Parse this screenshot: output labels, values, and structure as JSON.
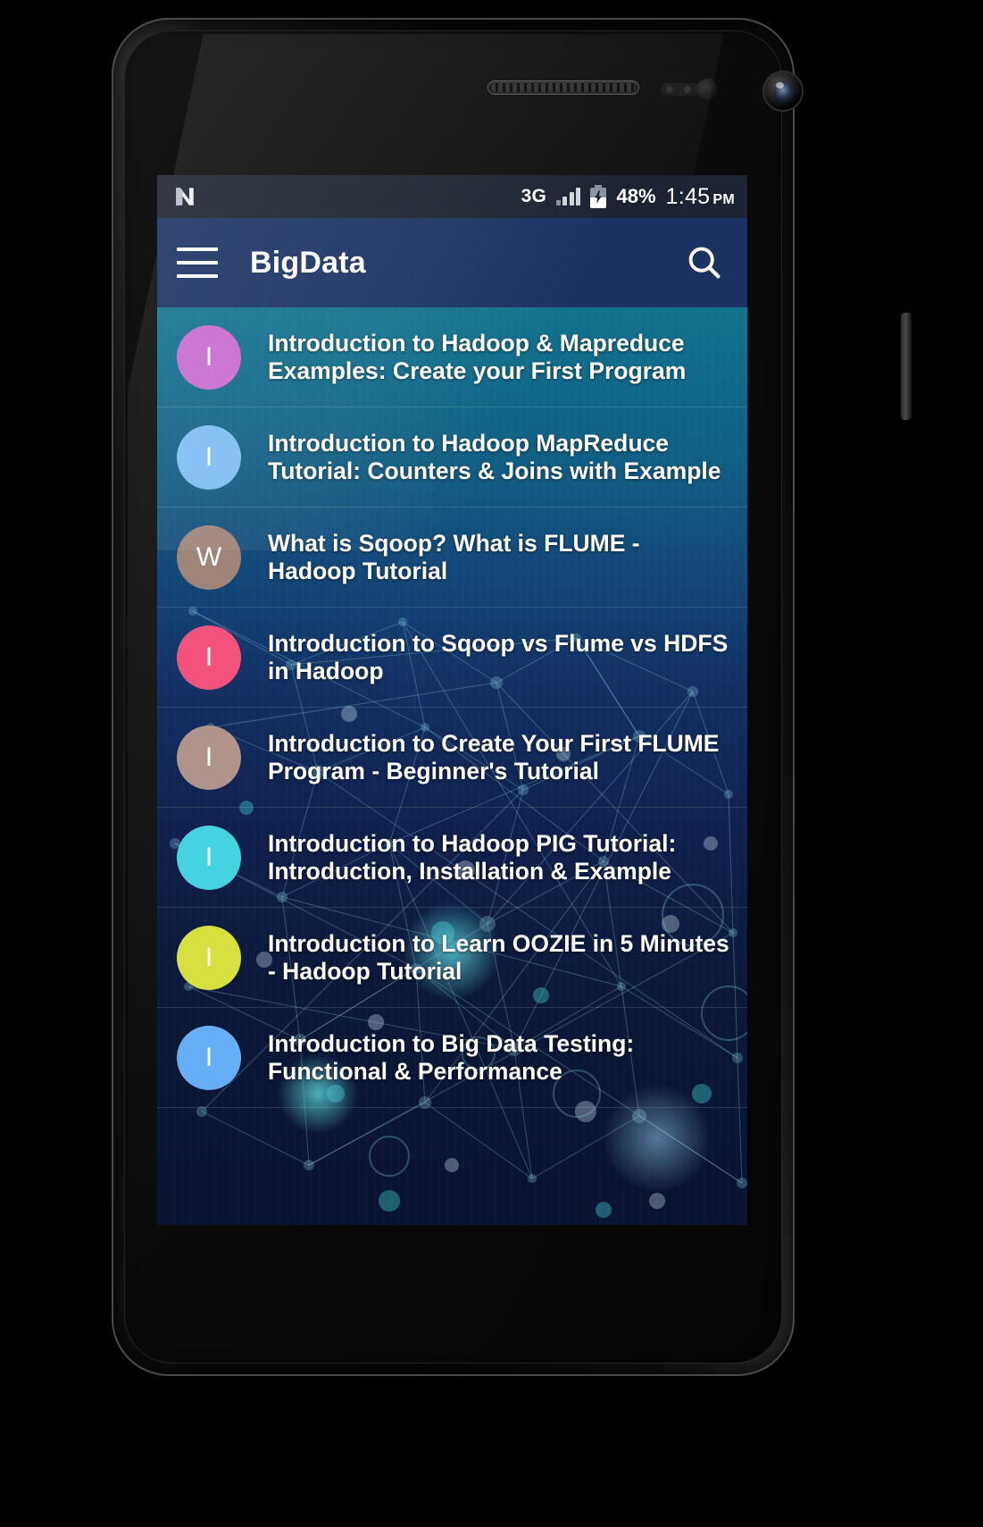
{
  "device": {
    "name": "android-phone",
    "earpiece": "speaker-grille",
    "front_camera": "front-camera"
  },
  "statusbar": {
    "logo": "android-n-logo",
    "network": "3G",
    "signal_icon": "signal-bars-icon",
    "signal_bars_active": 3,
    "signal_bars_total": 4,
    "battery_icon": "battery-charging-icon",
    "battery_percent": "48%",
    "battery_level": 48,
    "time": "1:45",
    "ampm": "PM"
  },
  "appbar": {
    "menu_icon": "hamburger-menu-icon",
    "title": "BigData",
    "search_icon": "search-icon",
    "background": "#1b3263"
  },
  "list": {
    "items": [
      {
        "initial": "I",
        "color": "#c96bd1",
        "title": "Introduction to Hadoop & Mapreduce Examples: Create your First Program"
      },
      {
        "initial": "I",
        "color": "#7fbdf2",
        "title": "Introduction to Hadoop MapReduce Tutorial: Counters & Joins with Example"
      },
      {
        "initial": "W",
        "color": "#9e8479",
        "title": "What is Sqoop? What is FLUME - Hadoop Tutorial"
      },
      {
        "initial": "I",
        "color": "#f2537d",
        "title": "Introduction to Sqoop vs Flume vs HDFS in Hadoop"
      },
      {
        "initial": "I",
        "color": "#b0938a",
        "title": "Introduction to Create Your First FLUME Program - Beginner's Tutorial"
      },
      {
        "initial": "I",
        "color": "#45d3e2",
        "title": "Introduction to Hadoop PIG Tutorial: Introduction, Installation & Example"
      },
      {
        "initial": "I",
        "color": "#d6e03f",
        "title": "Introduction to Learn OOZIE in 5 Minutes - Hadoop Tutorial"
      },
      {
        "initial": "I",
        "color": "#66aef5",
        "title": "Introduction to Big Data Testing: Functional & Performance"
      }
    ]
  },
  "theme": {
    "list_gradient_top": "#12738f",
    "list_gradient_bottom": "#0a1330",
    "statusbar_bg": "#1c2431",
    "text_color": "#ffffff"
  }
}
